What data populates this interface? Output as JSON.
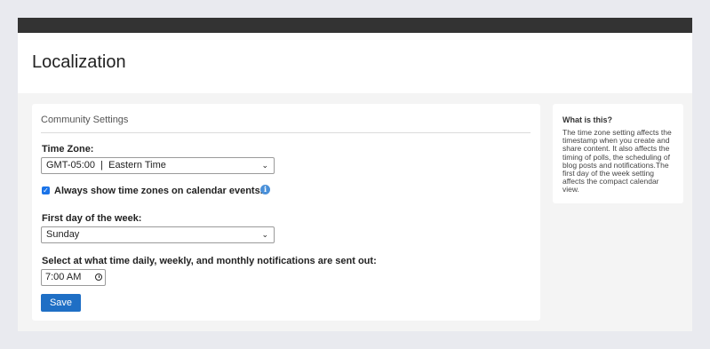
{
  "header": {
    "title": "Localization"
  },
  "main": {
    "section_title": "Community Settings",
    "time_zone": {
      "label": "Time Zone:",
      "value": "GMT-05:00  |  Eastern Time"
    },
    "show_time_zones": {
      "checked": true,
      "label": "Always show time zones on calendar events.",
      "info_icon": "info-icon"
    },
    "first_day": {
      "label": "First day of the week:",
      "value": "Sunday"
    },
    "notification_time": {
      "label": "Select at what time daily, weekly, and monthly notifications are sent out:",
      "value": "7:00 AM",
      "icon": "clock-icon"
    },
    "save_label": "Save"
  },
  "sidebar": {
    "title": "What is this?",
    "body": "The time zone setting affects the timestamp when you create and share content. It also affects the timing of polls, the scheduling of blog posts and notifications.The first day of the week setting affects the compact calendar view."
  },
  "colors": {
    "top_bar": "#333333",
    "primary_button": "#1f6fc5",
    "checkbox": "#1a73e8",
    "info_icon": "#4a90d9",
    "background": "#e9eaef"
  }
}
